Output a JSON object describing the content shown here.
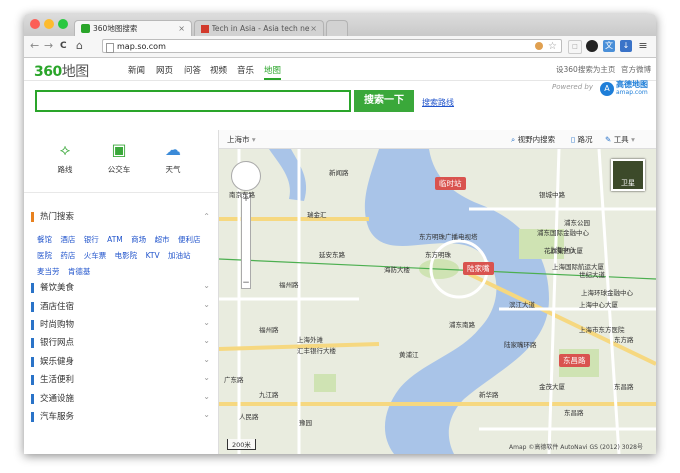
{
  "browser": {
    "tabs": [
      {
        "title": "360地图搜索",
        "close": "×"
      },
      {
        "title": "Tech in Asia - Asia tech new",
        "close": "×"
      }
    ],
    "nav": {
      "back": "←",
      "forward": "→",
      "reload": "C",
      "home": "⌂"
    },
    "url": "map.so.com",
    "menu_icon": "≡"
  },
  "site": {
    "logo_num": "360",
    "logo_cn": "地图",
    "nav_links": [
      "新闻",
      "网页",
      "问答",
      "视频",
      "音乐",
      "地图"
    ],
    "active_nav": "地图",
    "set_home": "设360搜索为主页",
    "weibo": "官方微博",
    "search_button": "搜索一下",
    "route_link": "搜索路线",
    "powered_by": "Powered by",
    "amap_cn": "高德地图",
    "amap_en": "amap.com"
  },
  "sidebar": {
    "quick": [
      {
        "label": "路线",
        "icon": "route-icon"
      },
      {
        "label": "公交车",
        "icon": "bus-icon"
      },
      {
        "label": "天气",
        "icon": "weather-icon"
      }
    ],
    "hot_title": "热门搜索",
    "hot_links": [
      "餐馆",
      "酒店",
      "银行",
      "ATM",
      "商场",
      "超市",
      "便利店",
      "医院",
      "药店",
      "火车票",
      "电影院",
      "KTV",
      "加油站",
      "麦当劳",
      "肯德基"
    ],
    "categories": [
      "餐饮美食",
      "酒店住宿",
      "时尚购物",
      "银行网点",
      "娱乐健身",
      "生活便利",
      "交通设施",
      "汽车服务"
    ]
  },
  "map_toolbar": {
    "city": "上海市",
    "nearby": "视野内搜索",
    "traffic": "路况",
    "tools": "工具"
  },
  "map": {
    "satellite": "卫星",
    "scale": "200米",
    "copyright": "Amap ©高德软件 AutoNavi GS (2012) 3028号",
    "badges": [
      {
        "text": "陆家嘴",
        "color": "#d9534f"
      },
      {
        "text": "临时站",
        "color": "#d9534f"
      },
      {
        "text": "东昌路",
        "color": "#d9534f"
      }
    ],
    "labels": [
      "新闻路",
      "瑞金汇",
      "浦东公园",
      "海防大楼",
      "东方明珠广播电视塔",
      "浦东国际金融中心",
      "花旗集团大厦",
      "上海国际航运大厦",
      "上海中心大厦",
      "上海环球金融中心",
      "上海市东方医院",
      "豫园",
      "人民路",
      "福州路",
      "延安东路",
      "世纪大道",
      "东昌路",
      "银城中路",
      "陆家嘴环路",
      "南京东路",
      "东方明珠",
      "金茂大厦",
      "上海外滩",
      "汇丰银行大楼",
      "黄浦江",
      "福州路",
      "广东路",
      "九江路",
      "浦东南路",
      "滨江大道",
      "上海中心",
      "东昌路",
      "新华路",
      "东方路"
    ]
  },
  "colors": {
    "brand_green": "#2aa52a",
    "link_blue": "#2255cc",
    "river": "#a9c4e8",
    "road": "#ffffff",
    "major_road": "#f6d880"
  }
}
